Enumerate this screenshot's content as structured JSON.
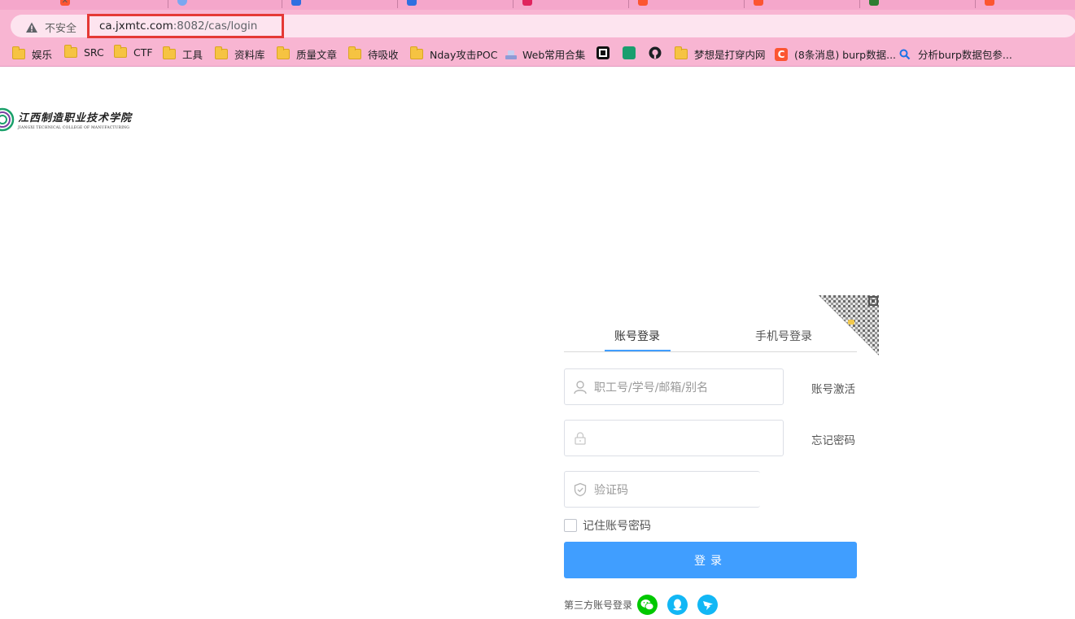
{
  "browser": {
    "security_label": "不安全",
    "url_host": "ca.jxmtc.com",
    "url_rest": ":8082/cas/login",
    "bookmarks": [
      {
        "label": "娱乐",
        "icon": "folder-icon"
      },
      {
        "label": "SRC",
        "icon": "folder-icon"
      },
      {
        "label": "CTF",
        "icon": "folder-icon"
      },
      {
        "label": "工具",
        "icon": "folder-icon"
      },
      {
        "label": "资料库",
        "icon": "folder-icon"
      },
      {
        "label": "质量文章",
        "icon": "folder-icon"
      },
      {
        "label": "待吸收",
        "icon": "folder-icon"
      },
      {
        "label": "Nday攻击POC",
        "icon": "folder-icon"
      },
      {
        "label": "Web常用合集",
        "icon": "web-icon"
      },
      {
        "label": "梦想是打穿内网",
        "icon": "folder-icon"
      },
      {
        "label": "(8条消息) burp数据...",
        "icon": "csdn-icon"
      },
      {
        "label": "分析burp数据包参...",
        "icon": "search-icon"
      }
    ]
  },
  "page": {
    "logo_cn": "江西制造职业技术学院",
    "logo_en": "JIANGXI TECHNICAL COLLEGE OF MANUFACTURING",
    "tabs": {
      "account_login": "账号登录",
      "phone_login": "手机号登录"
    },
    "form": {
      "username_placeholder": "职工号/学号/邮箱/别名",
      "captcha_placeholder": "验证码",
      "activate_link": "账号激活",
      "forgot_link": "忘记密码",
      "remember_label": "记住账号密码",
      "submit_label": "登录"
    },
    "third_party_label": "第三方账号登录",
    "colors": {
      "primary": "#409eff",
      "wechat": "#00c800",
      "qq": "#12b7f5"
    }
  }
}
